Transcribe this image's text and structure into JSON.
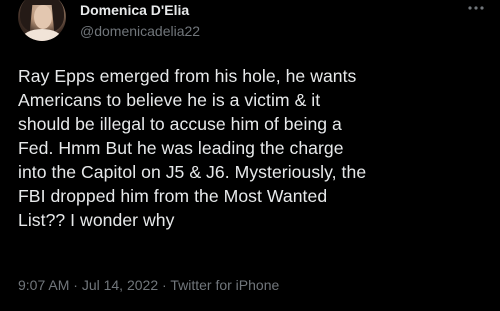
{
  "author": {
    "display_name": "Domenica D'Elia",
    "handle": "@domenicadelia22"
  },
  "menu_icon": "more-horizontal-icon",
  "tweet": {
    "text": "Ray Epps emerged from his hole, he wants\nAmericans to believe he is a victim & it\nshould be illegal to accuse him of being a\nFed. Hmm But he was leading the charge\ninto the Capitol on J5 & J6. Mysteriously, the\nFBI dropped him from the Most Wanted\nList?? I wonder why"
  },
  "meta": {
    "time": "9:07 AM",
    "separator1": " · ",
    "date": "Jul 14, 2022",
    "separator2": " · ",
    "source": "Twitter for iPhone"
  },
  "colors": {
    "background": "#000000",
    "primary_text": "#e7e9ea",
    "secondary_text": "#71767b"
  }
}
